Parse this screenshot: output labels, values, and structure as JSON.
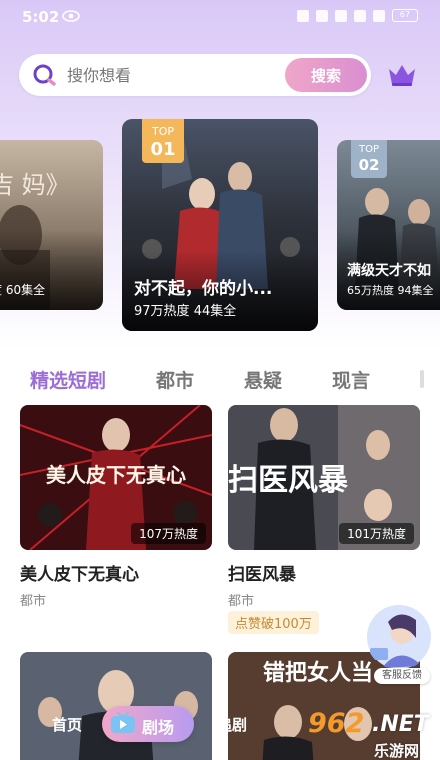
{
  "status_bar": {
    "time": "5:02",
    "battery": "67"
  },
  "search": {
    "placeholder": "搜你想看",
    "button_label": "搜索"
  },
  "carousel": [
    {
      "title_fragment": "吉 妈》",
      "meta": "度 60集全"
    },
    {
      "rank_label": "TOP",
      "rank": "01",
      "title": "对不起，你的小...",
      "heat": "97万热度",
      "episodes": "44集全"
    },
    {
      "rank_label": "TOP",
      "rank": "02",
      "title": "满级天才不如",
      "heat": "65万热度",
      "episodes": "94集全"
    }
  ],
  "tabs": [
    "精选短剧",
    "都市",
    "悬疑",
    "现言"
  ],
  "dramas": [
    {
      "poster_text": "美人皮下无真心",
      "title": "美人皮下无真心",
      "genre": "都市",
      "heat": "107万热度"
    },
    {
      "poster_text": "扫医风暴",
      "title": "扫医风暴",
      "genre": "都市",
      "heat": "101万热度",
      "like_badge": "点赞破100万"
    },
    {
      "poster_text": "",
      "title": "",
      "genre": ""
    },
    {
      "poster_text": "错把女人当",
      "title": "",
      "genre": ""
    }
  ],
  "service": {
    "label": "客服反馈"
  },
  "bottom_nav": {
    "home": "首页",
    "theater": "剧场",
    "history": "追剧"
  },
  "watermark": {
    "number": "962",
    "domain": ".NET",
    "site": "乐游网"
  },
  "colors": {
    "accent": "#9b6dd6",
    "search_button": "#e59ccb",
    "top1_badge": "#f4b85a",
    "top2_badge": "#9fb3c8",
    "like_badge_bg": "#fdf1d9"
  }
}
